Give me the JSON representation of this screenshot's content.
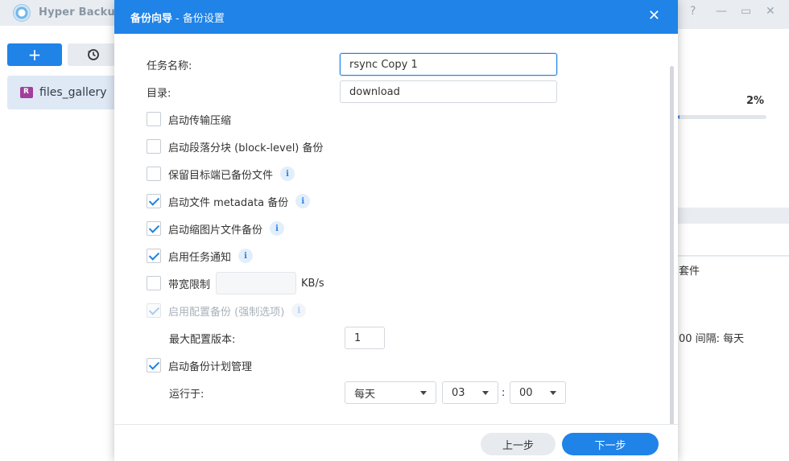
{
  "app": {
    "title": "Hyper Backup",
    "controls": {
      "help": "?",
      "minimize": "—",
      "maximize": "▭",
      "close": "✕"
    },
    "sidebar": {
      "add_label": "+",
      "task_name": "files_gallery"
    },
    "right_panel": {
      "percent": "2%",
      "progress": 0.02,
      "text1": "套件",
      "text2": "00 间隔: 每天"
    }
  },
  "dialog": {
    "title": "备份向导",
    "subtitle": "- 备份设置",
    "close_label": "✕",
    "fields": {
      "task_name_label": "任务名称:",
      "task_name_value": "rsync Copy 1",
      "directory_label": "目录:",
      "directory_value": "download",
      "bandwidth_unit": "KB/s",
      "bandwidth_value": "",
      "max_versions_label": "最大配置版本:",
      "max_versions_value": "1",
      "run_at_label": "运行于:",
      "frequency": "每天",
      "hour": "03",
      "time_sep": ":",
      "minute": "00"
    },
    "options": [
      {
        "label": "启动传输压缩",
        "checked": false
      },
      {
        "label": "启动段落分块 (block-level) 备份",
        "checked": false
      },
      {
        "label": "保留目标端已备份文件",
        "checked": false,
        "info": "i"
      },
      {
        "label": "启动文件 metadata 备份",
        "checked": true,
        "info": "i"
      },
      {
        "label": "启动缩图片文件备份",
        "checked": true,
        "info": "i"
      },
      {
        "label": "启用任务通知",
        "checked": true,
        "info": "i"
      },
      {
        "label": "带宽限制",
        "checked": false
      },
      {
        "label": "启用配置备份 (强制选项)",
        "checked": true,
        "disabled": true,
        "info": "i"
      },
      {
        "label": "启动备份计划管理",
        "checked": true
      }
    ],
    "buttons": {
      "prev": "上一步",
      "next": "下一步"
    }
  },
  "colors": {
    "accent": "#1f83e8",
    "header": "#1f83e8",
    "secondary_button": "#e7ebf0"
  }
}
